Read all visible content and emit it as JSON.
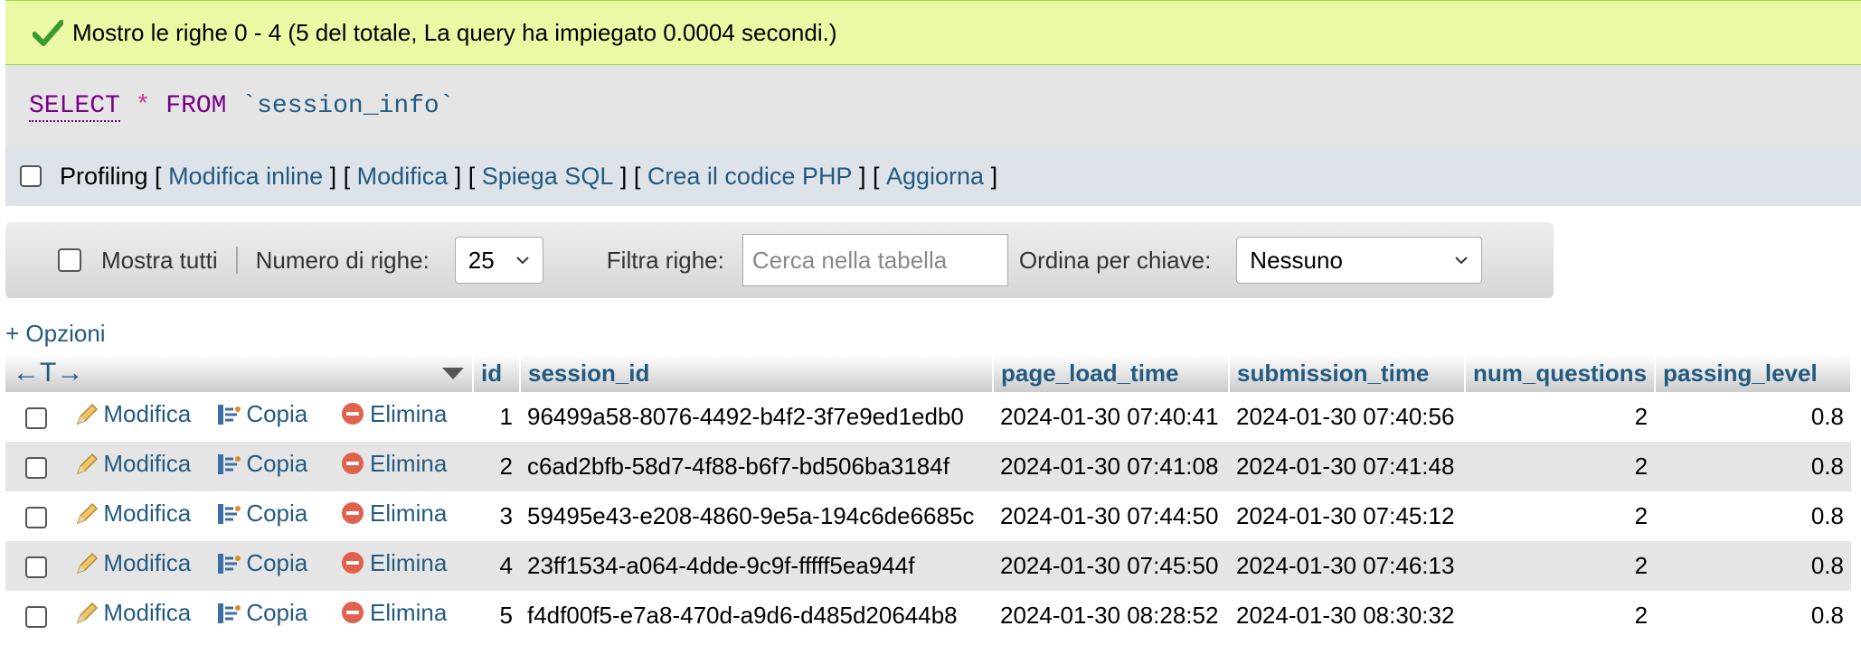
{
  "success": {
    "message": "Mostro le righe 0 - 4 (5 del totale, La query ha impiegato 0.0004 secondi.)",
    "icon": "check-icon"
  },
  "sql": {
    "select": "SELECT",
    "star": "*",
    "from": "FROM",
    "table": "`session_info`"
  },
  "profiling": {
    "label": "Profiling",
    "links": [
      "Modifica inline",
      "Modifica",
      "Spiega SQL",
      "Crea il codice PHP",
      "Aggiorna"
    ]
  },
  "nav": {
    "show_all": "Mostra tutti",
    "rows_label": "Numero di righe:",
    "rows_value": "25",
    "filter_label": "Filtra righe:",
    "filter_placeholder": "Cerca nella tabella",
    "sort_label": "Ordina per chiave:",
    "sort_value": "Nessuno"
  },
  "options_link": "+ Opzioni",
  "table": {
    "nav_arrows": "←T→",
    "columns": [
      "id",
      "session_id",
      "page_load_time",
      "submission_time",
      "num_questions",
      "passing_level"
    ],
    "actions": {
      "edit": "Modifica",
      "copy": "Copia",
      "delete": "Elimina"
    },
    "rows": [
      [
        "1",
        "96499a58-8076-4492-b4f2-3f7e9ed1edb0",
        "2024-01-30 07:40:41",
        "2024-01-30 07:40:56",
        "2",
        "0.8"
      ],
      [
        "2",
        "c6ad2bfb-58d7-4f88-b6f7-bd506ba3184f",
        "2024-01-30 07:41:08",
        "2024-01-30 07:41:48",
        "2",
        "0.8"
      ],
      [
        "3",
        "59495e43-e208-4860-9e5a-194c6de6685c",
        "2024-01-30 07:44:50",
        "2024-01-30 07:45:12",
        "2",
        "0.8"
      ],
      [
        "4",
        "23ff1534-a064-4dde-9c9f-fffff5ea944f",
        "2024-01-30 07:45:50",
        "2024-01-30 07:46:13",
        "2",
        "0.8"
      ],
      [
        "5",
        "f4df00f5-e7a8-470d-a9d6-d485d20644b8",
        "2024-01-30 08:28:52",
        "2024-01-30 08:30:32",
        "2",
        "0.8"
      ]
    ]
  },
  "colors": {
    "link": "#235a81",
    "success_bg": "#ebf8a4",
    "delete_icon": "#e0614d"
  }
}
